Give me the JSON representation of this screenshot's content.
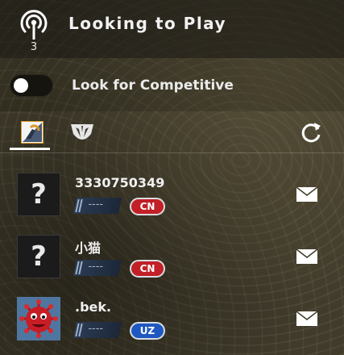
{
  "header": {
    "title": "Looking to Play",
    "broadcast_count": "3",
    "icon": "broadcast-icon"
  },
  "competitive": {
    "label": "Look for Competitive",
    "toggle_on": false
  },
  "tabs": [
    {
      "name": "counter-strike",
      "icon": "cs-logo-icon",
      "active": true
    },
    {
      "name": "danger-zone",
      "icon": "danger-zone-icon",
      "active": false
    }
  ],
  "refresh_icon": "refresh-icon",
  "friends": [
    {
      "name": "3330750349",
      "avatar": "unknown",
      "rank": "----",
      "country": "CN",
      "flag_color": "#c21f27"
    },
    {
      "name": "小猫",
      "avatar": "unknown",
      "rank": "----",
      "country": "CN",
      "flag_color": "#c21f27"
    },
    {
      "name": ".bek.",
      "avatar": "virus-image",
      "rank": "----",
      "country": "UZ",
      "flag_color": "#1f58c1"
    }
  ],
  "avatar_placeholder": "?",
  "invite_icon": "mail-icon"
}
